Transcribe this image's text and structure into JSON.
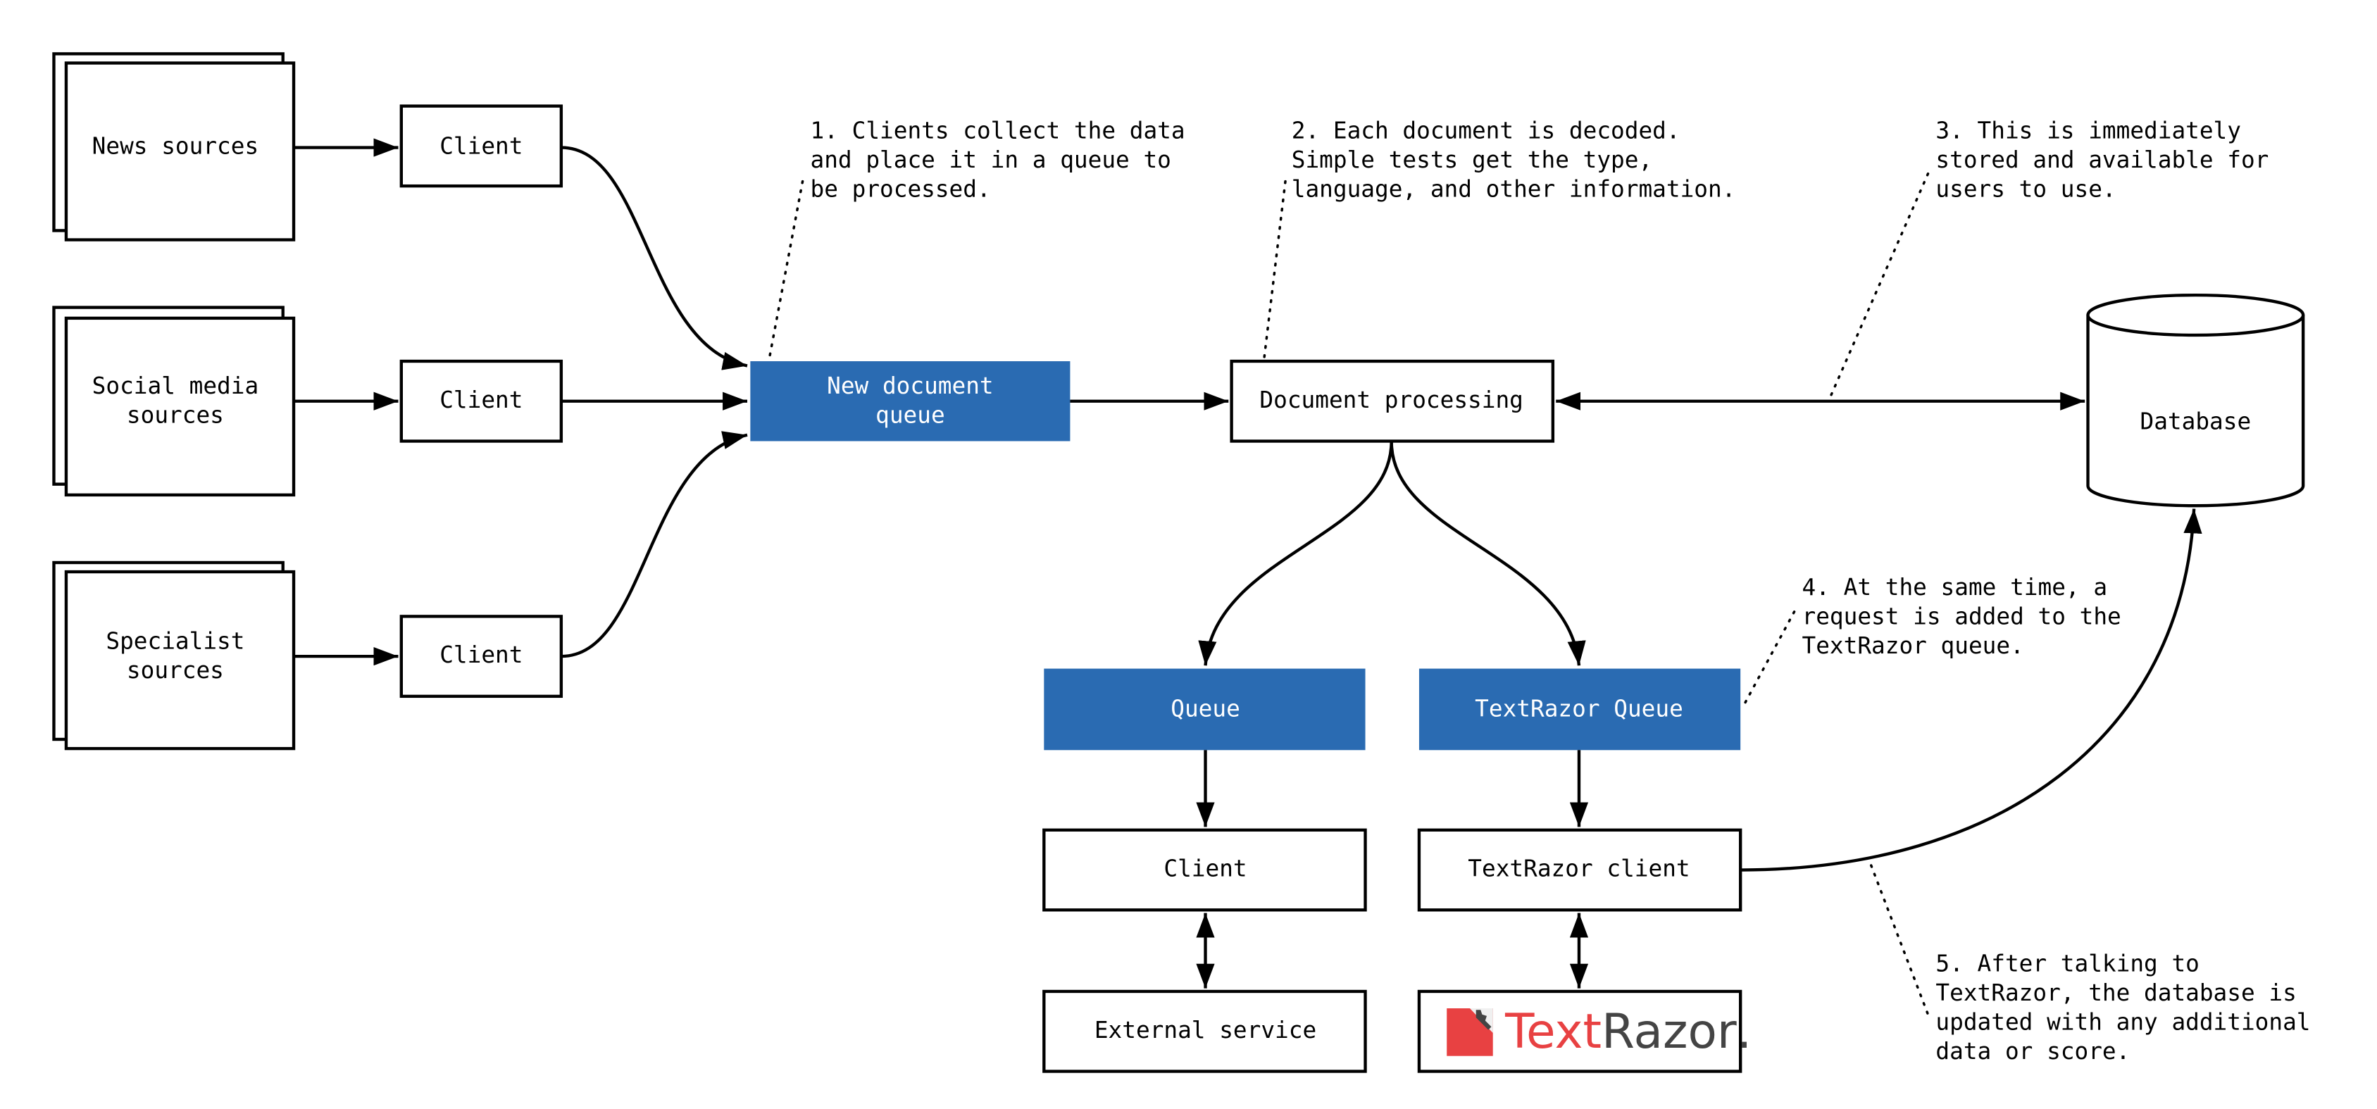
{
  "diagram": {
    "sources": [
      {
        "label_lines": [
          "News sources"
        ]
      },
      {
        "label_lines": [
          "Social media",
          "sources"
        ]
      },
      {
        "label_lines": [
          "Specialist",
          "sources"
        ]
      }
    ],
    "clients": [
      "Client",
      "Client",
      "Client"
    ],
    "new_queue": {
      "label_lines": [
        "New document",
        "queue"
      ]
    },
    "doc_processing": "Document processing",
    "database": "Database",
    "queue": "Queue",
    "textrazor_queue": "TextRazor Queue",
    "client_bottom": "Client",
    "textrazor_client": "TextRazor client",
    "external_service": "External service",
    "logo": {
      "part1": "Text",
      "part2": "Razor",
      "part3": "."
    },
    "notes": [
      {
        "lines": [
          "1. Clients collect the data",
          "and place it in a queue to",
          "be processed."
        ]
      },
      {
        "lines": [
          "2. Each document is decoded.",
          "Simple tests get the type,",
          "language, and other information."
        ]
      },
      {
        "lines": [
          "3. This is immediately",
          "stored and available for",
          "users to use."
        ]
      },
      {
        "lines": [
          "4. At the same time, a",
          "request is added to the",
          "TextRazor queue."
        ]
      },
      {
        "lines": [
          "5. After talking to",
          "TextRazor, the database is",
          "updated with any  additional",
          "data or score."
        ]
      }
    ],
    "colors": {
      "queue_blue": "#2a6bb2",
      "logo_red": "#e84142",
      "logo_gray": "#444444"
    }
  }
}
